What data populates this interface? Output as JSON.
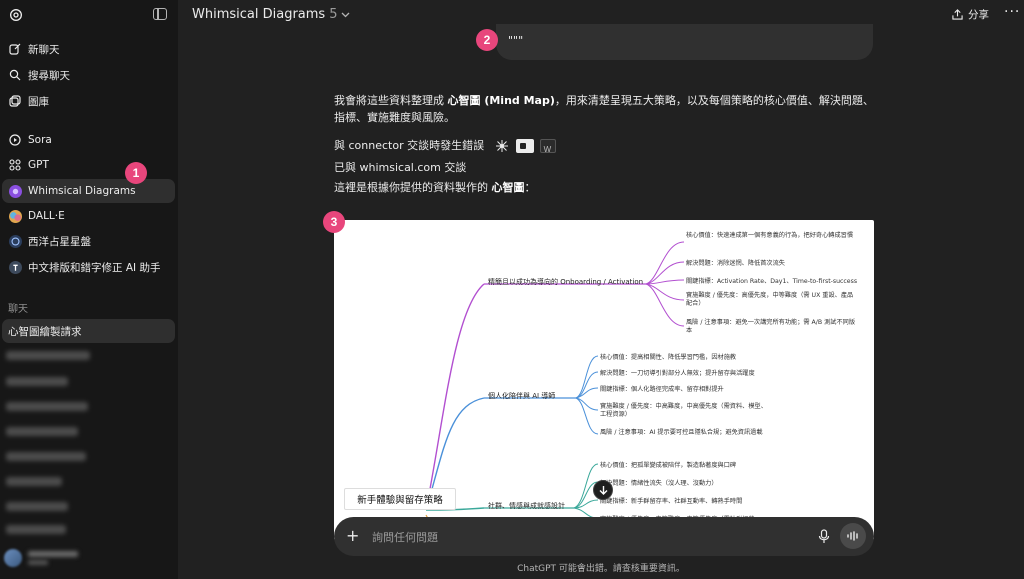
{
  "sidebar": {
    "nav": [
      {
        "label": "新聊天",
        "icon": "new-chat-icon"
      },
      {
        "label": "搜尋聊天",
        "icon": "search-icon"
      },
      {
        "label": "圖庫",
        "icon": "gallery-icon"
      }
    ],
    "apps": [
      {
        "label": "Sora",
        "icon": "play-icon"
      },
      {
        "label": "GPT",
        "icon": "grid-icon"
      },
      {
        "label": "Whimsical Diagrams",
        "icon": "whimsical-icon",
        "active": true
      },
      {
        "label": "DALL·E",
        "icon": "dalle-icon"
      },
      {
        "label": "西洋占星星盤",
        "icon": "astrology-icon"
      },
      {
        "label": "中文排版和錯字修正 AI 助手",
        "icon": "typography-icon"
      }
    ],
    "section_label": "聊天",
    "current_chat": "心智圖繪製請求"
  },
  "header": {
    "title": "Whimsical Diagrams",
    "version": "5",
    "share_label": "分享",
    "more": "···"
  },
  "message": {
    "quote": "\"\"\"",
    "intro_prefix": "我會將這些資料整理成 ",
    "intro_bold": "心智圖 (Mind Map)",
    "intro_suffix": "，用來清楚呈現五大策略，以及每個策略的核心價值、解決問題、指標、實施難度與風險。",
    "connector_error": "與 connector 交談時發生錯誤",
    "talked_with": "已與 whimsical.com 交談",
    "result_prefix": "這裡是根據你提供的資料製作的 ",
    "result_bold": "心智圖",
    "result_suffix": "："
  },
  "mindmap": {
    "root": "新手體驗與留存策略",
    "branches": [
      {
        "label": "精簡且以成功為導向的 Onboarding / Activation",
        "color": "#b24fd0",
        "items": [
          "核心價值：快速達成第一個有意義的行為，把好奇心轉成習慣",
          "解決問題：消除迷惘、降低首次流失",
          "關鍵指標：Activation Rate、Day1、Time-to-first-success",
          "實施難度 / 優先度：高優先度，中等難度（需 UX 重設、產品配合）",
          "風險 / 注意事項：避免一次講完所有功能；需 A/B 測試不同版本"
        ]
      },
      {
        "label": "個人化陪伴與 AI 導師",
        "color": "#4a90d9",
        "items": [
          "核心價值：提高相關性、降低學習門檻，因材施教",
          "解決問題：一刀切導引對部分人無效；提升留存與活躍度",
          "關鍵指標：個人化路徑完成率、留存相對提升",
          "實施難度 / 優先度：中高難度，中高優先度（需資料、模型、工程資源）",
          "風險 / 注意事項：AI 提示要可控且隱私合規；避免資訊過載"
        ]
      },
      {
        "label": "社群、情感與成就感設計",
        "color": "#3aa89a",
        "items": [
          "核心價值：把孤單變成被陪伴，製造黏著度與口碑",
          "解決問題：情緒性流失（沒人理、沒動力）",
          "關鍵指標：新手群留存率、社群互動率、轉熟手時間",
          "實施難度 / 優先度：中等難度，中等優先度（需社群經營"
        ]
      }
    ]
  },
  "composer": {
    "placeholder": "詢問任何問題"
  },
  "footer": "ChatGPT 可能會出錯。請查核重要資訊。",
  "badges": [
    "1",
    "2",
    "3"
  ],
  "colors": {
    "background": "#212121",
    "sidebar": "#171717",
    "badge": "#e8467c"
  }
}
